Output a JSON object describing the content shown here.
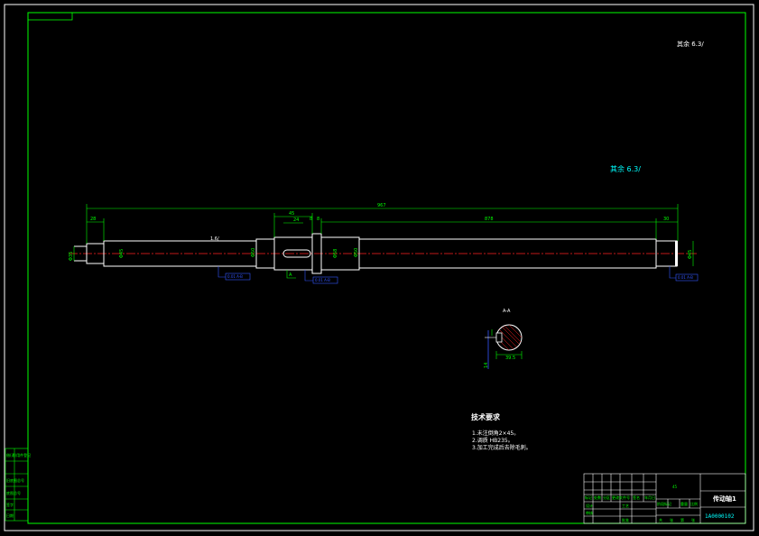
{
  "drawing": {
    "general_roughness": "其余 6.3/",
    "general_roughness_cyan": "其余 6.3/",
    "dimensions": {
      "overall_length": "967",
      "left_journal_length": "28",
      "keyway_length": "45",
      "keyway_offset": "24",
      "gap_a": "8",
      "gap_b": "8",
      "middle_length": "878",
      "right_length": "30",
      "left_journal_dia": "Φ35",
      "shaft_dia_1": "Φ45",
      "shaft_dia_2": "Φ50",
      "collar_dia": "Φ58",
      "shaft_dia_3": "Φ50",
      "right_journal_dia": "Φ45",
      "local_roughness": "1.6/",
      "section_label": "A-A",
      "keyway_depth": "39.5",
      "keyway_width": "14",
      "section_marker": "A"
    },
    "tolerance_frames": [
      "0.01 A-B",
      "0.01 A-B",
      "0.01 A-B"
    ]
  },
  "technical_requirements": {
    "heading": "技术要求",
    "items": [
      "1.未注倒角2×45。",
      "2.调质 HB235。",
      "3.加工完成后去除毛刺。"
    ]
  },
  "title_block": {
    "part_name": "传动轴1",
    "drawing_code": "1A0000102",
    "material": "45",
    "labels": [
      "设计",
      "审核",
      "工艺",
      "批准",
      "标记",
      "处数",
      "分区",
      "更改文件号",
      "签名",
      "年月日",
      "阶段标记",
      "重量",
      "比例",
      "共",
      "张",
      "第",
      "张"
    ]
  },
  "left_margin_table": {
    "rows": [
      "借(通)用件登记",
      "",
      "旧底图总号",
      "底图总号",
      "签字",
      "日期"
    ]
  }
}
